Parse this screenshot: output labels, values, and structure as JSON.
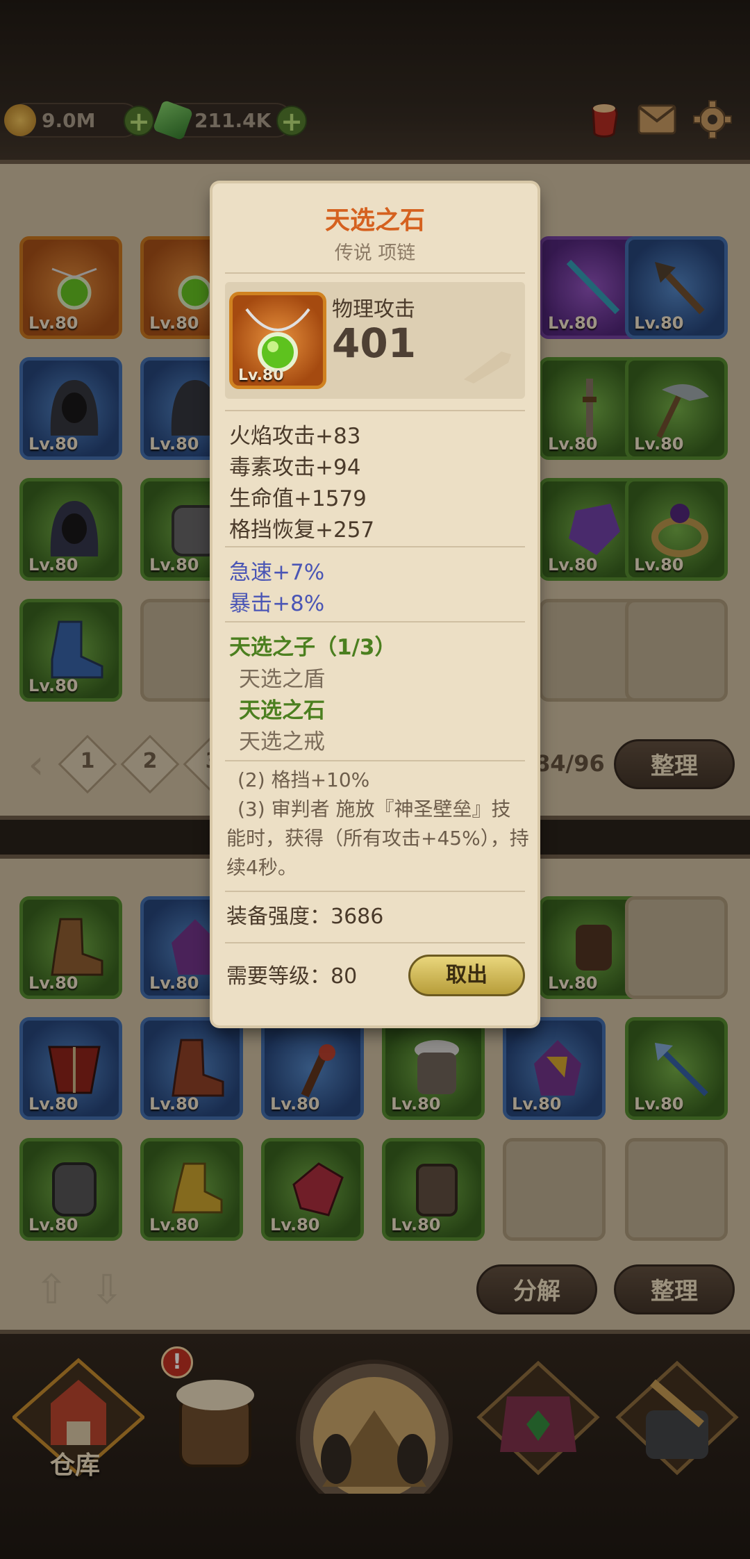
{
  "currency": {
    "gold": "9.0M",
    "gems": "211.4K"
  },
  "top_icons": [
    "potion-icon",
    "mail-icon",
    "gear-icon"
  ],
  "upper_grid": {
    "level_label": "Lv.80",
    "pages": [
      "1",
      "2",
      "3"
    ],
    "count": "84/96",
    "sort_label": "整理"
  },
  "lower_grid": {
    "level_label": "Lv.80",
    "disassemble_label": "分解",
    "sort_label": "整理"
  },
  "bottom_nav": {
    "warehouse_label": "仓库",
    "alert": "!"
  },
  "popup": {
    "title": "天选之石",
    "subtitle": "传说 项链",
    "item_level": "Lv.80",
    "main_stat_label": "物理攻击",
    "main_stat_value": "401",
    "stats": [
      "火焰攻击+83",
      "毒素攻击+94",
      "生命值+1579",
      "格挡恢复+257"
    ],
    "bonus_stats": [
      "急速+7%",
      "暴击+8%"
    ],
    "set_name": "天选之子（1/3）",
    "set_items": [
      "天选之盾",
      "天选之石",
      "天选之戒"
    ],
    "set_bonus_2": "(2) 格挡+10%",
    "set_bonus_3": "(3) 审判者 施放『神圣壁垒』技能时，获得（所有攻击+45%），持续4秒。",
    "gear_score": "装备强度：3686",
    "required_level": "需要等级：80",
    "take_out_label": "取出"
  },
  "colors": {
    "title_orange": "#d5611f",
    "bonus_blue": "#4a55b5",
    "set_green": "#4b7f1f"
  }
}
